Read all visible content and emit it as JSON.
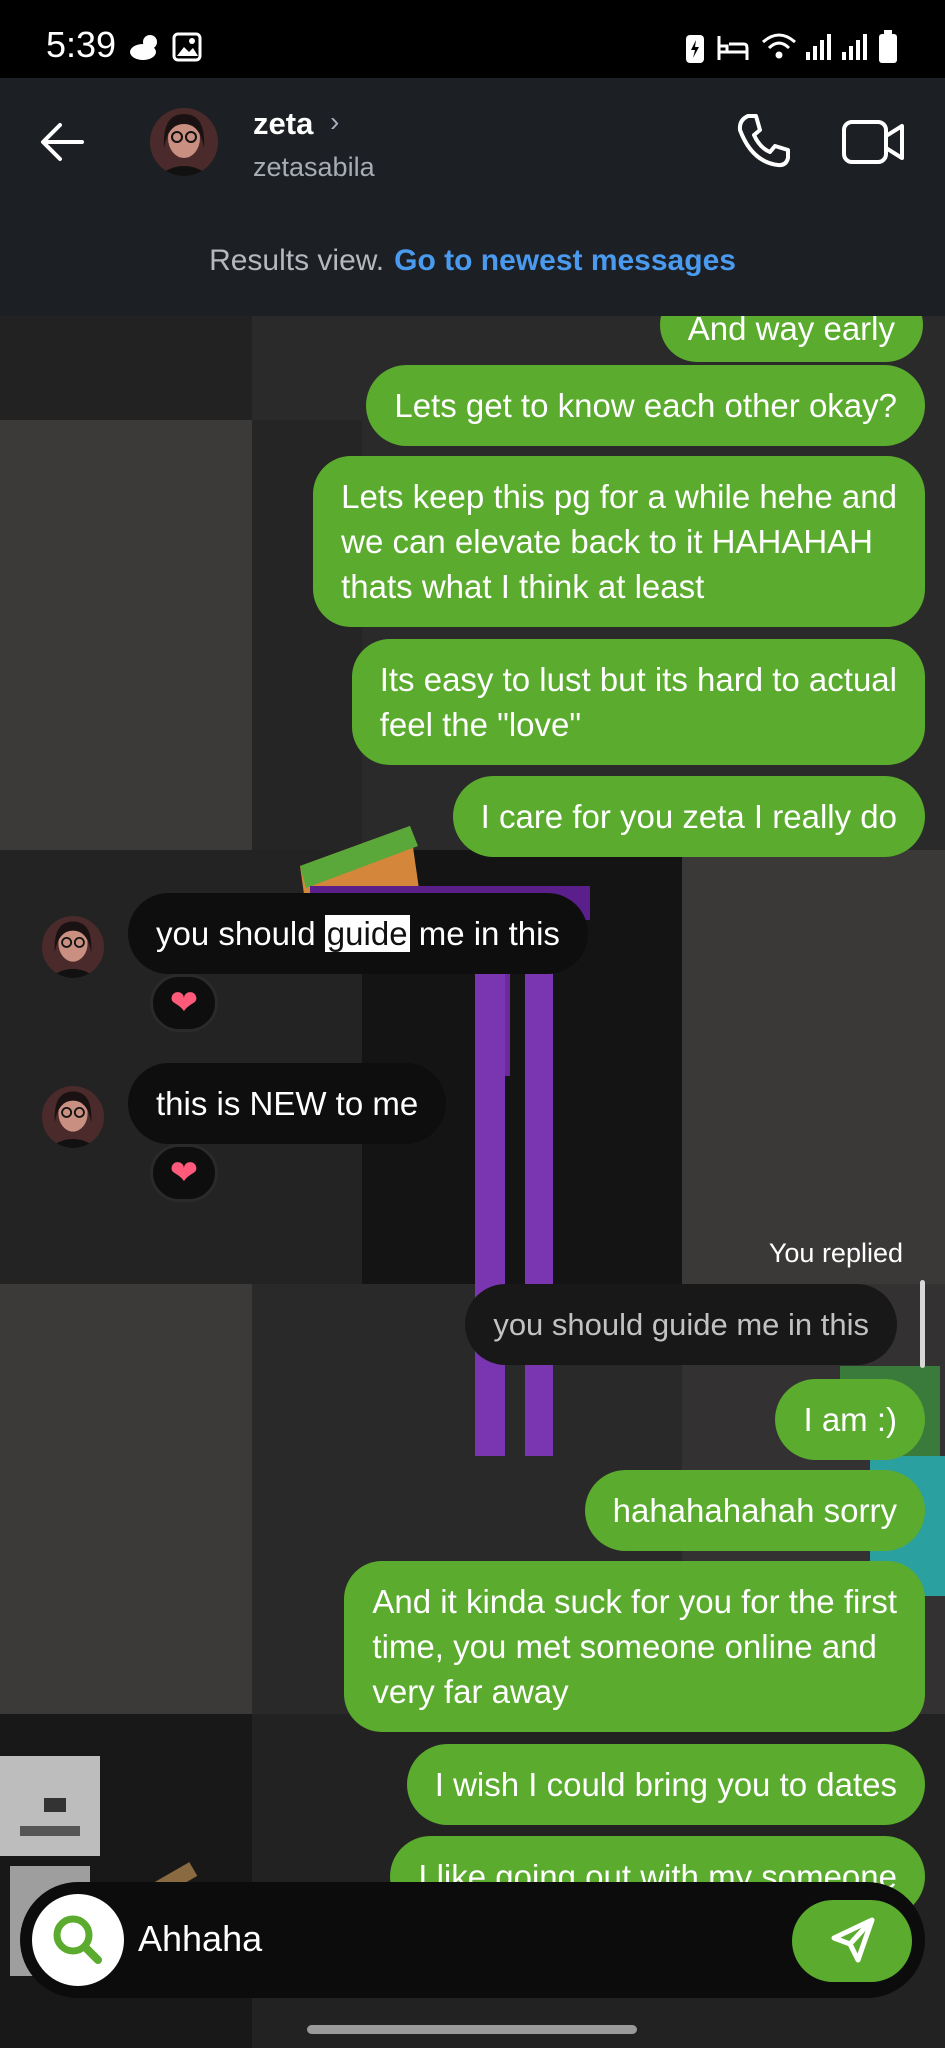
{
  "status_bar": {
    "time": "5:39"
  },
  "header": {
    "name": "zeta",
    "username": "zetasabila"
  },
  "results_banner": {
    "label": "Results view.",
    "link": "Go to newest messages"
  },
  "messages": {
    "m0": "And way early",
    "m1": "Lets get to know each other okay?",
    "m2": [
      "Lets keep this pg for a while hehe and",
      "we can elevate back to it HAHAHAH",
      "thats what I think at least"
    ],
    "m3": [
      "Its easy to lust but its hard to actual",
      "feel the \"love\""
    ],
    "m4": "I care for you zeta I really do",
    "m5": {
      "before": "you should ",
      "highlight": "guide",
      "after": " me in this"
    },
    "m6": "this is NEW to me",
    "replied_label": "You replied",
    "quoted": "you should guide me in this",
    "m7": "I am :)",
    "m8": "hahahahahah sorry",
    "m9": [
      "And it kinda suck for you for the first",
      "time, you met someone online and",
      "very far away"
    ],
    "m10": "I wish I could bring you to dates",
    "m11": "I like going out with my someone"
  },
  "reactions": {
    "r1": "heart",
    "r2": "heart"
  },
  "composer": {
    "text": "Ahhaha"
  },
  "colors": {
    "outgoing": "#5aab2e",
    "incoming": "#0e0e0e",
    "link": "#4a9bf0",
    "header_bg": "#1c1f24"
  }
}
